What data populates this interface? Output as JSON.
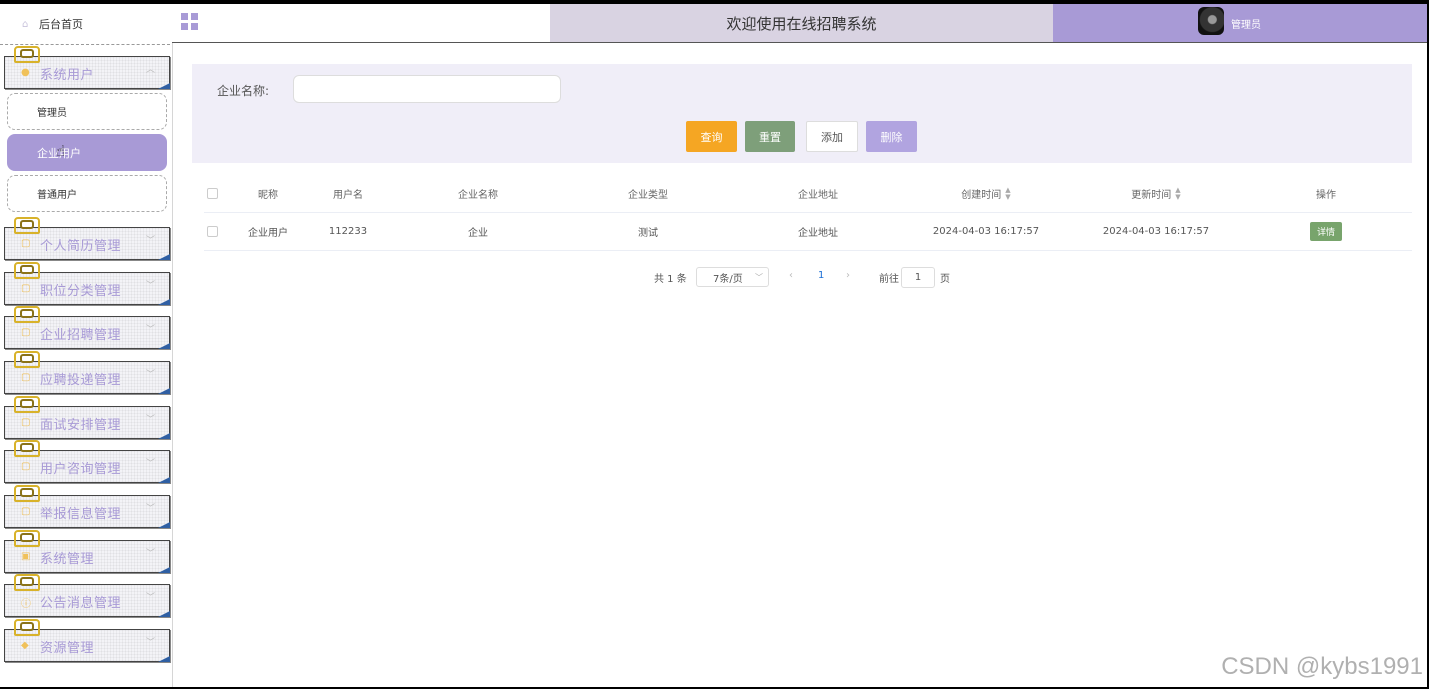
{
  "sidebar": {
    "home": "后台首页",
    "groups": [
      {
        "label": "系统用户",
        "icon": "user-icon"
      },
      {
        "label": "个人简历管理",
        "icon": "folder-icon"
      },
      {
        "label": "职位分类管理",
        "icon": "folder-icon"
      },
      {
        "label": "企业招聘管理",
        "icon": "folder-icon"
      },
      {
        "label": "应聘投递管理",
        "icon": "folder-icon"
      },
      {
        "label": "面试安排管理",
        "icon": "folder-icon"
      },
      {
        "label": "用户咨询管理",
        "icon": "folder-icon"
      },
      {
        "label": "举报信息管理",
        "icon": "folder-icon"
      },
      {
        "label": "系统管理",
        "icon": "settings-icon"
      },
      {
        "label": "公告消息管理",
        "icon": "info-icon"
      },
      {
        "label": "资源管理",
        "icon": "shield-icon"
      }
    ],
    "sub_items": [
      "管理员",
      "企业用户",
      "普通用户"
    ],
    "active_sub": "企业用户"
  },
  "header": {
    "title": "欢迎使用在线招聘系统",
    "user": "管理员"
  },
  "search": {
    "label": "企业名称:",
    "value": "",
    "buttons": {
      "query": "查询",
      "reset": "重置",
      "add": "添加",
      "delete": "删除"
    }
  },
  "table": {
    "columns": [
      "昵称",
      "用户名",
      "企业名称",
      "企业类型",
      "企业地址",
      "创建时间",
      "更新时间",
      "操作"
    ],
    "rows": [
      {
        "nickname": "企业用户",
        "username": "112233",
        "company": "企业",
        "type": "测试",
        "address": "企业地址",
        "created": "2024-04-03 16:17:57",
        "updated": "2024-04-03 16:17:57",
        "action": "详情"
      }
    ]
  },
  "pagination": {
    "total": "共 1 条",
    "page_size": "7条/页",
    "current_page": "1",
    "goto_label": "前往",
    "goto_value": "1",
    "goto_unit": "页"
  },
  "watermark": "CSDN @kybs1991",
  "colors": {
    "accent": "#a89ad6",
    "header_mid": "#d9d3e2",
    "query": "#f5a623",
    "reset": "#7e9f7a",
    "delete": "#b1a4e0",
    "detail": "#78a46c"
  }
}
